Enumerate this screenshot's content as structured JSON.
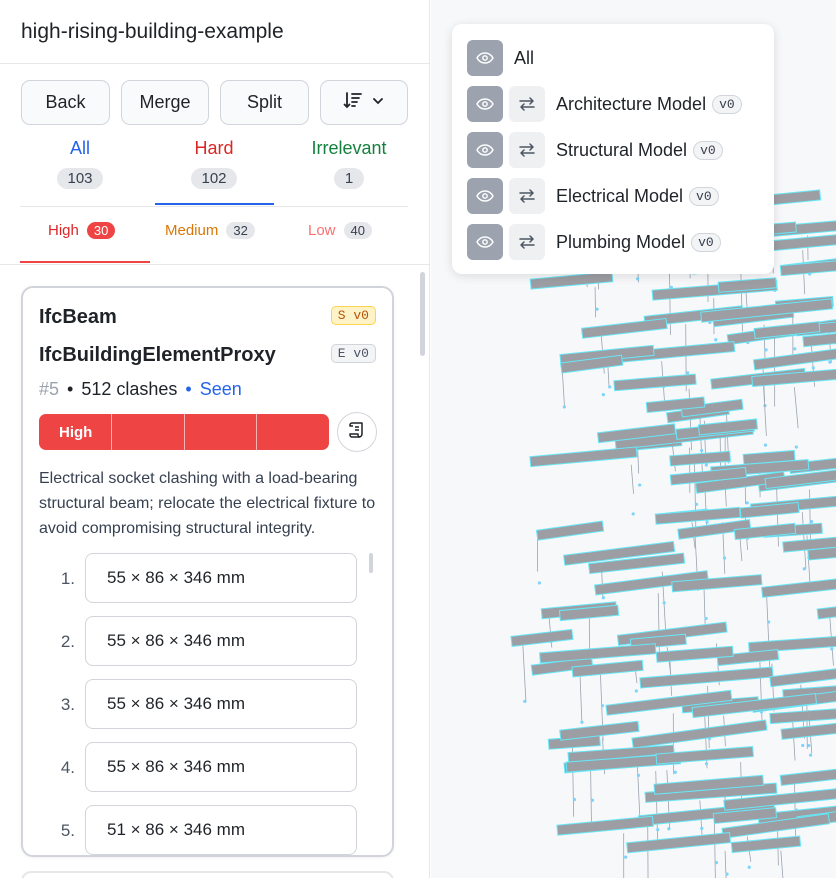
{
  "project_title": "high-rising-building-example",
  "toolbar": {
    "back": "Back",
    "merge": "Merge",
    "split": "Split"
  },
  "categories": [
    {
      "label": "All",
      "count": "103",
      "color": "#2563eb"
    },
    {
      "label": "Hard",
      "count": "102",
      "color": "#dc2626"
    },
    {
      "label": "Irrelevant",
      "count": "1",
      "color": "#15803d"
    }
  ],
  "severities": [
    {
      "label": "High",
      "count": "30",
      "color": "#dc2626",
      "pill_bg": "#ef4444",
      "pill_fg": "#ffffff"
    },
    {
      "label": "Medium",
      "count": "32",
      "color": "#d97706",
      "pill_bg": "#e5e7eb",
      "pill_fg": "#374151"
    },
    {
      "label": "Low",
      "count": "40",
      "color": "#f87171",
      "pill_bg": "#e5e7eb",
      "pill_fg": "#374151"
    }
  ],
  "card": {
    "element_a": "IfcBeam",
    "tag_a": "S v0",
    "element_b": "IfcBuildingElementProxy",
    "tag_b": "E v0",
    "id": "#5",
    "clashes": "512 clashes",
    "status": "Seen",
    "severity_label": "High",
    "severity_level": 1.0,
    "description": "Electrical socket clashing with a load-bearing structural beam; relocate the electrical fixture to avoid compromising structural integrity.",
    "items": [
      {
        "num": "1.",
        "dims": "55 × 86 × 346 mm"
      },
      {
        "num": "2.",
        "dims": "55 × 86 × 346 mm"
      },
      {
        "num": "3.",
        "dims": "55 × 86 × 346 mm"
      },
      {
        "num": "4.",
        "dims": "55 × 86 × 346 mm"
      },
      {
        "num": "5.",
        "dims": "51 × 86 × 346 mm"
      }
    ]
  },
  "models": {
    "all_label": "All",
    "list": [
      {
        "name": "Architecture Model",
        "version": "v0"
      },
      {
        "name": "Structural Model",
        "version": "v0"
      },
      {
        "name": "Electrical Model",
        "version": "v0"
      },
      {
        "name": "Plumbing Model",
        "version": "v0"
      }
    ]
  },
  "icons": {
    "sort": "sort-lines-icon",
    "chevron": "chevron-down-icon",
    "note": "scroll-note-icon",
    "eye": "eye-icon",
    "swap": "swap-arrows-icon"
  }
}
